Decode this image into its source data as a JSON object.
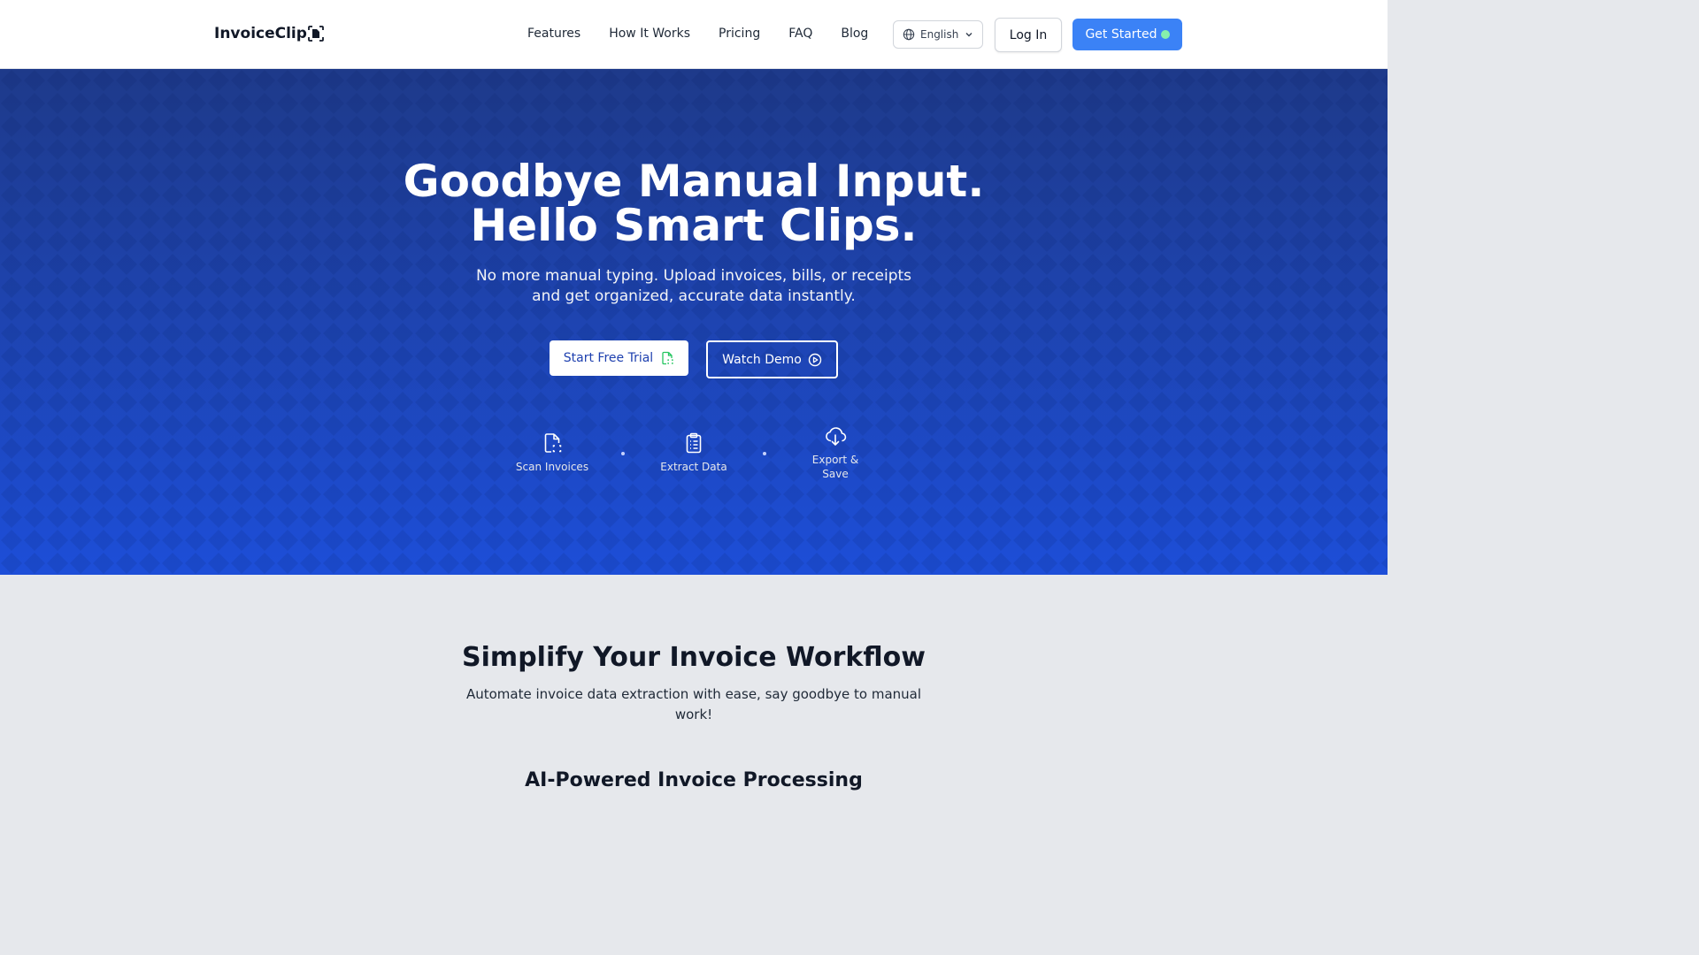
{
  "header": {
    "logo_text": "InvoiceClip",
    "nav": [
      "Features",
      "How It Works",
      "Pricing",
      "FAQ",
      "Blog"
    ],
    "language": "English",
    "login_label": "Log In",
    "get_started_label": "Get Started"
  },
  "hero": {
    "title_line1": "Goodbye Manual Input.",
    "title_line2": "Hello Smart Clips.",
    "subtitle": "No more manual typing. Upload invoices, bills, or receipts and get organized, accurate data instantly.",
    "primary_cta": "Start Free Trial",
    "secondary_cta": "Watch Demo",
    "steps": [
      {
        "label": "Scan Invoices",
        "icon": "file-scan-icon"
      },
      {
        "label": "Extract Data",
        "icon": "clipboard-list-icon"
      },
      {
        "label": "Export & Save",
        "icon": "cloud-download-icon"
      }
    ]
  },
  "workflow": {
    "title": "Simplify Your Invoice Workflow",
    "subtitle": "Automate invoice data extraction with ease, say goodbye to manual work!",
    "next_heading": "AI-Powered Invoice Processing"
  },
  "colors": {
    "primary": "#3b82f6",
    "hero_top": "#1e3a8a",
    "hero_bottom": "#1d4ed8",
    "status_dot": "#86efac",
    "trial_icon": "#22c55e"
  }
}
